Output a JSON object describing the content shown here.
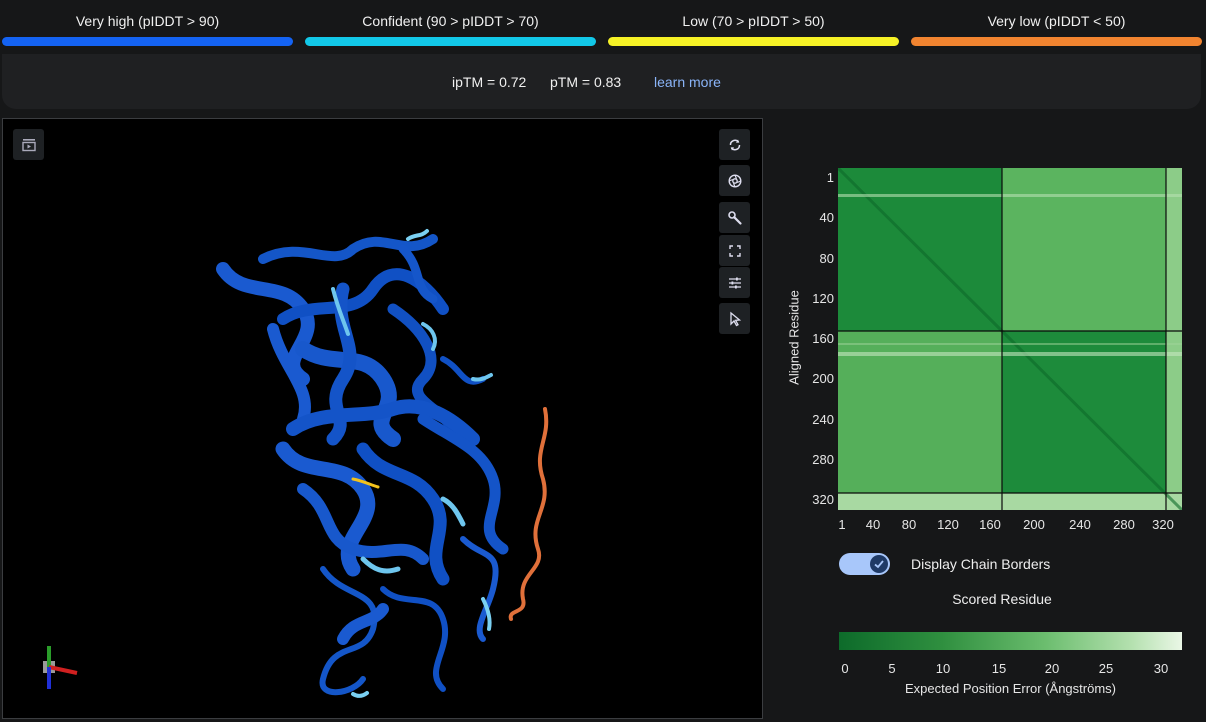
{
  "legend": [
    {
      "label": "Very high (pIDDT > 90)",
      "color": "#1463f3"
    },
    {
      "label": "Confident (90 > pIDDT > 70)",
      "color": "#12c8e8"
    },
    {
      "label": "Low (70 > pIDDT > 50)",
      "color": "#f6f226"
    },
    {
      "label": "Very low (pIDDT < 50)",
      "color": "#f18430"
    }
  ],
  "scores": {
    "iptm": "ipTM = 0.72",
    "ptm": "pTM = 0.83",
    "learn_more": "learn more"
  },
  "toolbar": {
    "icons": [
      "sequence-panel-icon",
      "reset-rotation-icon",
      "screenshot-icon",
      "settings-wrench-icon",
      "fullscreen-icon",
      "adjust-icon",
      "select-cursor-icon"
    ]
  },
  "pae": {
    "y_axis_title": "Aligned Residue",
    "x_axis_title": "Scored Residue",
    "y_ticks": [
      "1",
      "40",
      "80",
      "120",
      "160",
      "200",
      "240",
      "280",
      "320"
    ],
    "x_ticks": [
      "1",
      "40",
      "80",
      "120",
      "160",
      "200",
      "240",
      "280",
      "320"
    ],
    "chain_border_residue": 163,
    "total_residues": 330,
    "toggle_label": "Display Chain Borders",
    "toggle_on": true,
    "colorbar_ticks": [
      "0",
      "5",
      "10",
      "15",
      "20",
      "25",
      "30"
    ],
    "colorbar_title": "Expected Position Error (Ångströms)"
  }
}
